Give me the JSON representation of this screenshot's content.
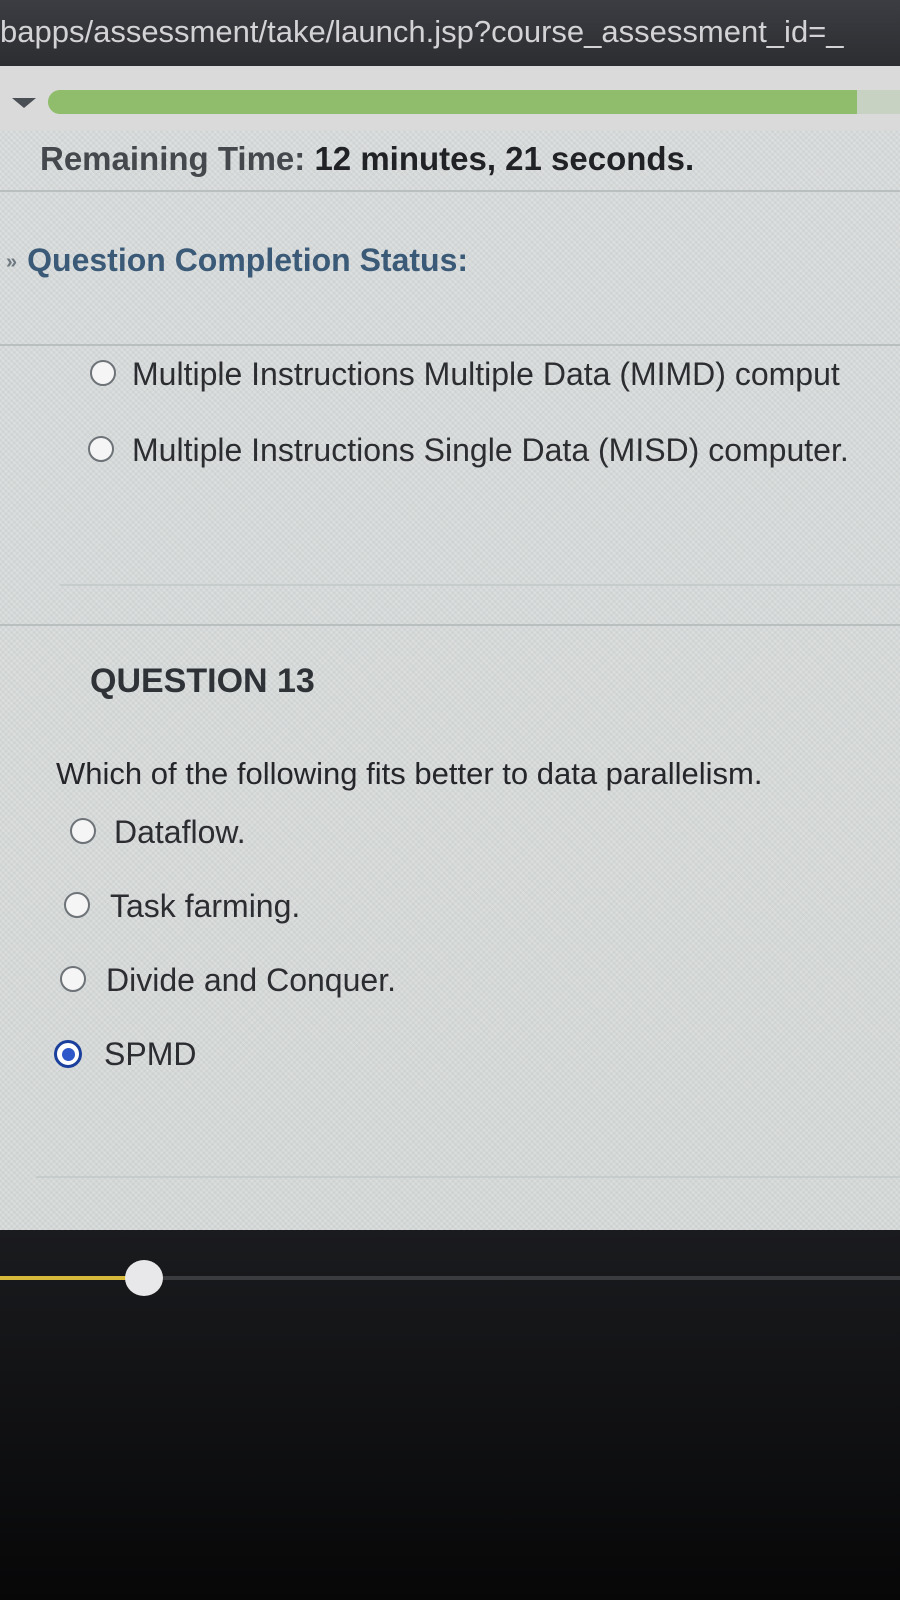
{
  "browser": {
    "url": "bapps/assessment/take/launch.jsp?course_assessment_id=_"
  },
  "assessment": {
    "timer_label": "Remaining Time:",
    "timer_value": "12 minutes, 21 seconds.",
    "completion_status_label": "Question Completion Status:"
  },
  "previous_question": {
    "options": [
      {
        "label": "Multiple Instructions Multiple Data (MIMD) comput",
        "selected": false
      },
      {
        "label": "Multiple Instructions Single Data (MISD) computer.",
        "selected": false
      }
    ]
  },
  "question": {
    "title": "QUESTION 13",
    "text": "Which of the following fits better to data parallelism.",
    "options": [
      {
        "label": "Dataflow.",
        "selected": false
      },
      {
        "label": "Task farming.",
        "selected": false
      },
      {
        "label": "Divide and Conquer.",
        "selected": false
      },
      {
        "label": "SPMD",
        "selected": true
      }
    ]
  },
  "completion_progress": 0.95,
  "scroll_position": 0.16,
  "colors": {
    "progress_fill": "#8fbd6b",
    "heading_blue": "#3a5a78",
    "radio_selected": "#2e57c9",
    "slider_fill": "#d6b83a"
  }
}
